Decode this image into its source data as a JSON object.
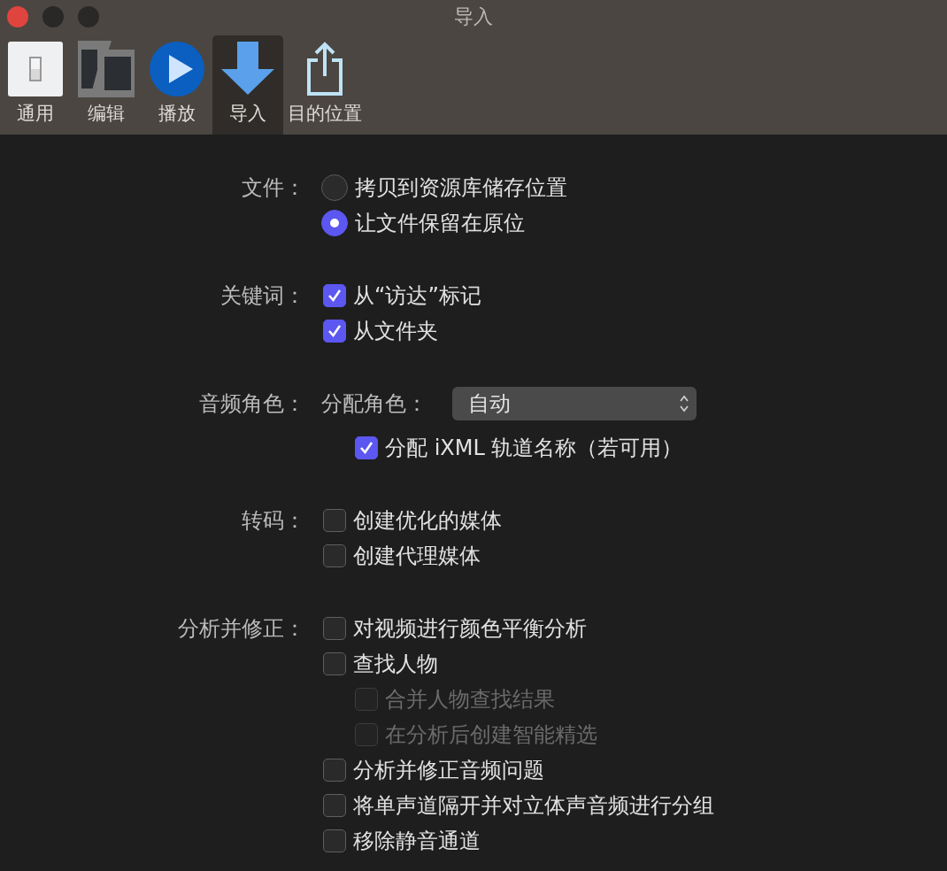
{
  "window": {
    "title": "导入"
  },
  "tabs": [
    {
      "label": "通用",
      "selected": false
    },
    {
      "label": "编辑",
      "selected": false
    },
    {
      "label": "播放",
      "selected": false
    },
    {
      "label": "导入",
      "selected": true
    },
    {
      "label": "目的位置",
      "selected": false
    }
  ],
  "sections": [
    {
      "label": "文件：",
      "kind": "radio",
      "options": [
        {
          "label": "拷贝到资源库储存位置",
          "selected": false
        },
        {
          "label": "让文件保留在原位",
          "selected": true
        }
      ]
    },
    {
      "label": "关键词：",
      "kind": "checkbox",
      "options": [
        {
          "label": "从“访达”标记",
          "checked": true,
          "disabled": false
        },
        {
          "label": "从文件夹",
          "checked": true,
          "disabled": false
        }
      ]
    },
    {
      "label": "音频角色：",
      "kind": "popup",
      "field_label": "分配角色：",
      "value": "自动",
      "options": [
        {
          "label": "分配 iXML 轨道名称（若可用）",
          "checked": true,
          "disabled": false
        }
      ]
    },
    {
      "label": "转码：",
      "kind": "checkbox",
      "options": [
        {
          "label": "创建优化的媒体",
          "checked": false,
          "disabled": false
        },
        {
          "label": "创建代理媒体",
          "checked": false,
          "disabled": false
        }
      ]
    },
    {
      "label": "分析并修正：",
      "kind": "checkbox",
      "options": [
        {
          "label": "对视频进行颜色平衡分析",
          "checked": false,
          "disabled": false
        },
        {
          "label": "查找人物",
          "checked": false,
          "disabled": false,
          "children": [
            {
              "label": "合并人物查找结果",
              "checked": false,
              "disabled": true
            },
            {
              "label": "在分析后创建智能精选",
              "checked": false,
              "disabled": true
            }
          ]
        },
        {
          "label": "分析并修正音频问题",
          "checked": false,
          "disabled": false
        },
        {
          "label": "将单声道隔开并对立体声音频进行分组",
          "checked": false,
          "disabled": false
        },
        {
          "label": "移除静音通道",
          "checked": false,
          "disabled": false
        }
      ]
    }
  ]
}
